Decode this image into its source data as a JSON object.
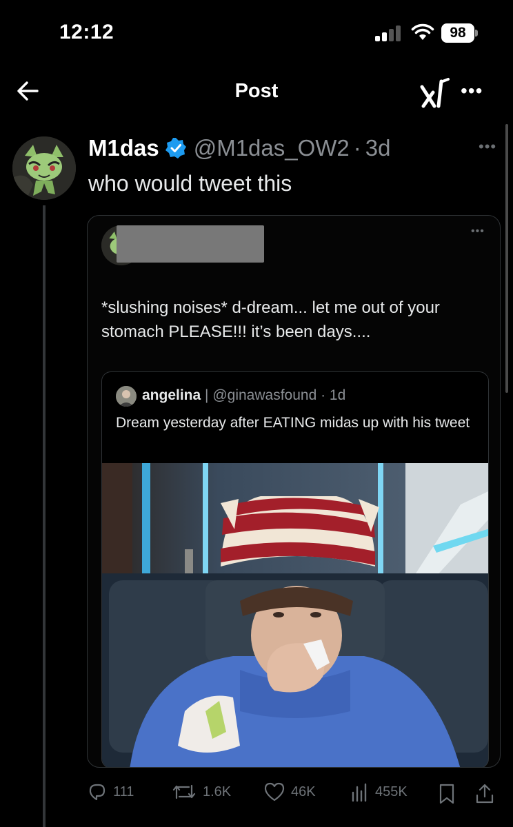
{
  "status_bar": {
    "time": "12:12",
    "battery": "98"
  },
  "nav": {
    "title": "Post",
    "back_icon": "arrow-left-icon",
    "grok_icon": "grok-icon",
    "more_icon": "more-horizontal-icon"
  },
  "tweet": {
    "display_name": "M1das",
    "handle": "@M1das_OW2",
    "separator": "·",
    "time": "3d",
    "text": "who would tweet this",
    "verified_icon": "verified-badge-icon"
  },
  "quote": {
    "text": "*slushing noises* d-dream... let me out of your stomach PLEASE!!! it’s been days....",
    "nested": {
      "name": "angelina",
      "separator": " | ",
      "handle": "@ginawasfound",
      "dot": " · ",
      "time": "1d",
      "text": "Dream yesterday after EATING midas up with his tweet"
    }
  },
  "actions": {
    "replies": "111",
    "reposts": "1.6K",
    "likes": "46K",
    "views": "455K"
  },
  "colors": {
    "background": "#000000",
    "verified": "#1d9bf0",
    "muted_text": "#8b8f94",
    "border": "#2f3336"
  }
}
